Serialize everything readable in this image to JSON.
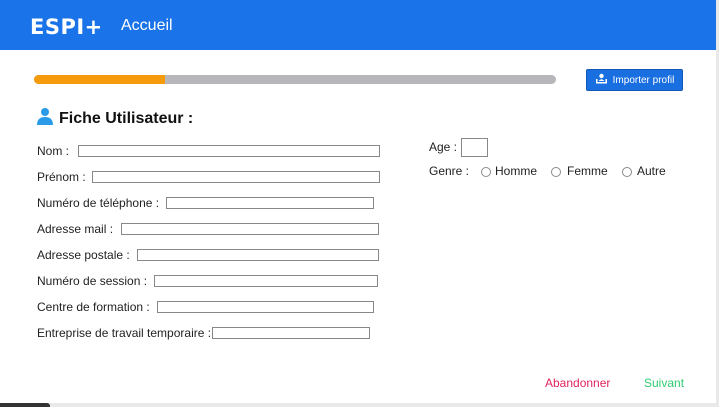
{
  "header": {
    "logo": "ESPI+",
    "nav_home": "Accueil",
    "bg_color": "#1a73e8"
  },
  "progress": {
    "value": 0.25,
    "fill_color": "#f59a0a",
    "track_color": "#b6b6bb"
  },
  "import_button": {
    "label": "Importer profil",
    "icon": "user-import-icon"
  },
  "form": {
    "title": "Fiche Utilisateur :",
    "title_icon": "person-icon",
    "fields": [
      {
        "label": "Nom :",
        "value": ""
      },
      {
        "label": "Prénom :",
        "value": ""
      },
      {
        "label": "Numéro de téléphone :",
        "value": ""
      },
      {
        "label": "Adresse mail :",
        "value": ""
      },
      {
        "label": "Adresse postale :",
        "value": ""
      },
      {
        "label": "Numéro de session :",
        "value": ""
      },
      {
        "label": "Centre de formation :",
        "value": ""
      },
      {
        "label": "Entreprise de travail temporaire :",
        "value": ""
      }
    ],
    "age": {
      "label": "Age :",
      "value": ""
    },
    "gender": {
      "label": "Genre :",
      "options": [
        "Homme",
        "Femme",
        "Autre"
      ],
      "selected": null
    }
  },
  "footer": {
    "cancel_label": "Abandonner",
    "cancel_color": "#e0245e",
    "next_label": "Suivant",
    "next_color": "#2ecc71"
  }
}
